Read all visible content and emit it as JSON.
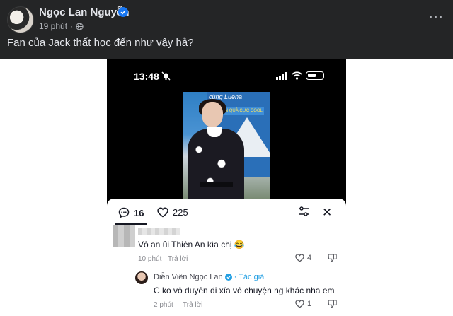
{
  "post": {
    "author": "Ngọc Lan Nguyễn",
    "time": "19 phút",
    "dot": "·",
    "caption": "Fan của Jack thất học đến như vậy hả?",
    "more": "···"
  },
  "phone": {
    "clock": "13:48"
  },
  "video": {
    "banner_text": "cùng Luena",
    "banner_sub": "NHẬN QUÀ CỰC COOL"
  },
  "sheet": {
    "comment_count": "16",
    "like_count": "225",
    "close": "✕"
  },
  "comments": [
    {
      "text": "Vô an ủi Thiên An kìa chị 😂",
      "time": "10 phút",
      "reply": "Trả lời",
      "likes": "4"
    },
    {
      "name": "Diễn Viên Ngọc Lan",
      "badge": "· Tác giả",
      "text": "C ko vô duyên đi xía vô chuyện ng khác nha em",
      "time": "2 phút",
      "reply": "Trả lời",
      "likes": "1"
    }
  ],
  "colors": {
    "facebook_bg": "#242526",
    "verified_blue": "#1877f2",
    "tiktok_author": "#25a0e3"
  },
  "icons": [
    "verified-icon",
    "globe-icon",
    "more-icon",
    "bell-muted-icon",
    "signal-icon",
    "wifi-icon",
    "battery-icon",
    "comment-icon",
    "heart-icon",
    "filter-icon",
    "close-icon",
    "dislike-icon"
  ]
}
